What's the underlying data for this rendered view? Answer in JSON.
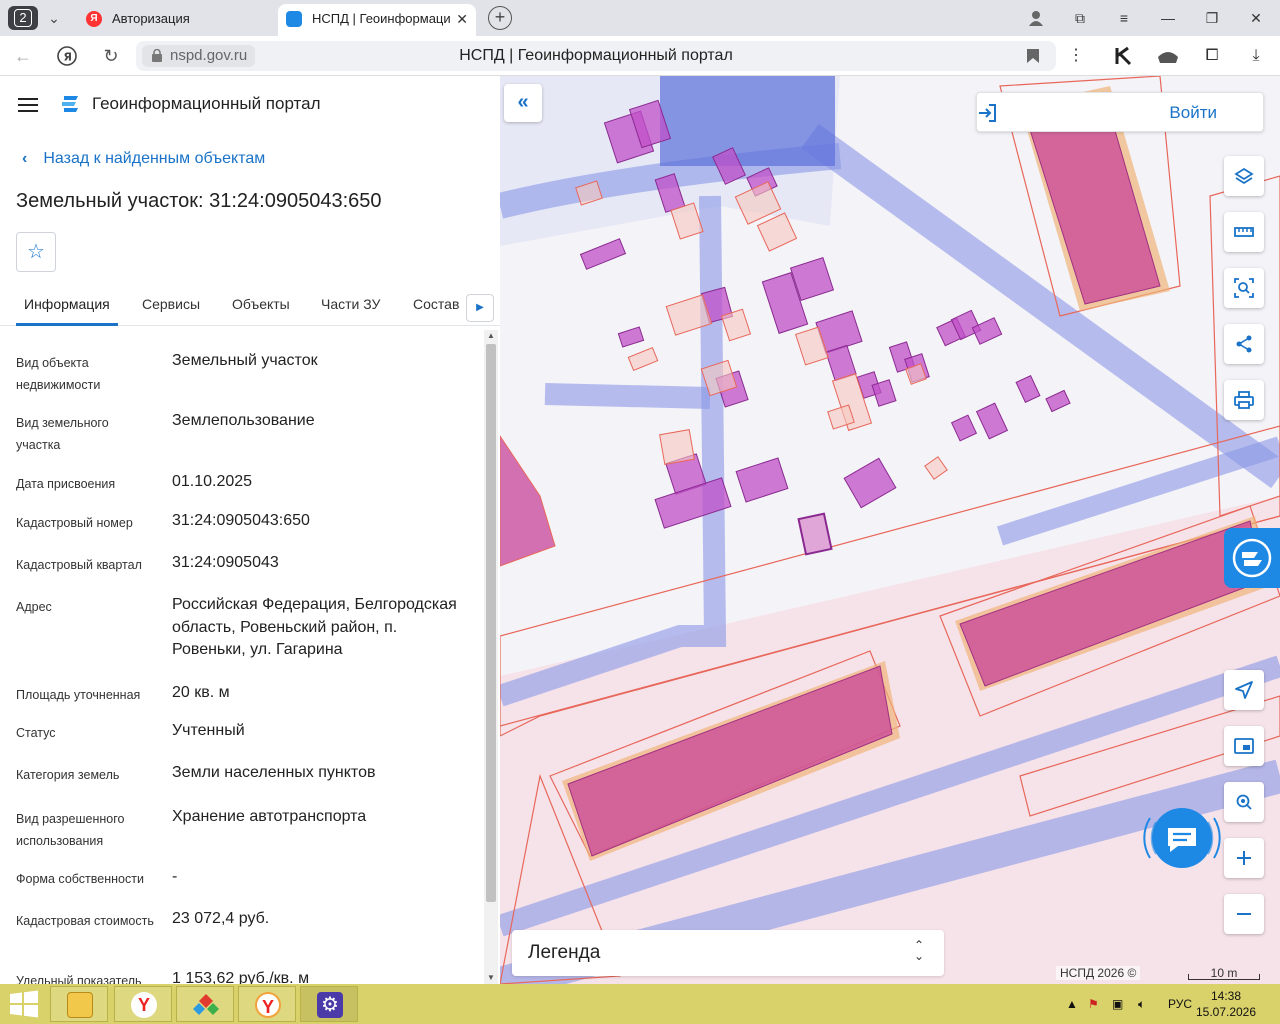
{
  "browser": {
    "tab_count": "2",
    "tabs": [
      {
        "label": "Авторизация"
      },
      {
        "label": "НСПД | Геоинформаци"
      }
    ],
    "url_domain": "nspd.gov.ru",
    "page_title": "НСПД | Геоинформационный портал"
  },
  "panel": {
    "portal_title": "Геоинформационный портал",
    "back_link": "Назад к найденным объектам",
    "object_title": "Земельный участок: 31:24:0905043:650",
    "tabs": [
      "Информация",
      "Сервисы",
      "Объекты",
      "Части ЗУ",
      "Состав"
    ],
    "fields": [
      {
        "label": "Вид объекта недвижимости",
        "value": "Земельный участок"
      },
      {
        "label": "Вид земельного участка",
        "value": "Землепользование"
      },
      {
        "label": "Дата присвоения",
        "value": "01.10.2025"
      },
      {
        "label": "Кадастровый номер",
        "value": "31:24:0905043:650"
      },
      {
        "label": "Кадастровый квартал",
        "value": "31:24:0905043"
      },
      {
        "label": "Адрес",
        "value": "Российская Федерация, Белгородская область, Ровеньский район, п. Ровеньки, ул. Гагарина"
      },
      {
        "label": "Площадь уточненная",
        "value": "20 кв. м"
      },
      {
        "label": "Статус",
        "value": "Учтенный"
      },
      {
        "label": "Категория земель",
        "value": "Земли населенных пунктов"
      },
      {
        "label": "Вид разрешенного использования",
        "value": "Хранение автотранспорта"
      },
      {
        "label": "Форма собственности",
        "value": "-"
      },
      {
        "label": "Кадастровая стоимость",
        "value": "23 072,4 руб."
      },
      {
        "label": "Удельный показатель",
        "value": "1 153,62 руб./кв. м"
      }
    ]
  },
  "map": {
    "login_label": "Войти",
    "legend_label": "Легенда",
    "copyright": "НСПД 2026 ©",
    "scale_label": "10 m",
    "tools_top": [
      "layers-icon",
      "ruler-icon",
      "search-area-icon",
      "share-icon",
      "print-icon"
    ],
    "tools_bottom": [
      "locate-icon",
      "minimap-icon",
      "geo-search-icon",
      "zoom-in-icon",
      "zoom-out-icon"
    ]
  },
  "taskbar": {
    "language": "РУС",
    "time": "14:38",
    "date": "15.07.2026"
  }
}
